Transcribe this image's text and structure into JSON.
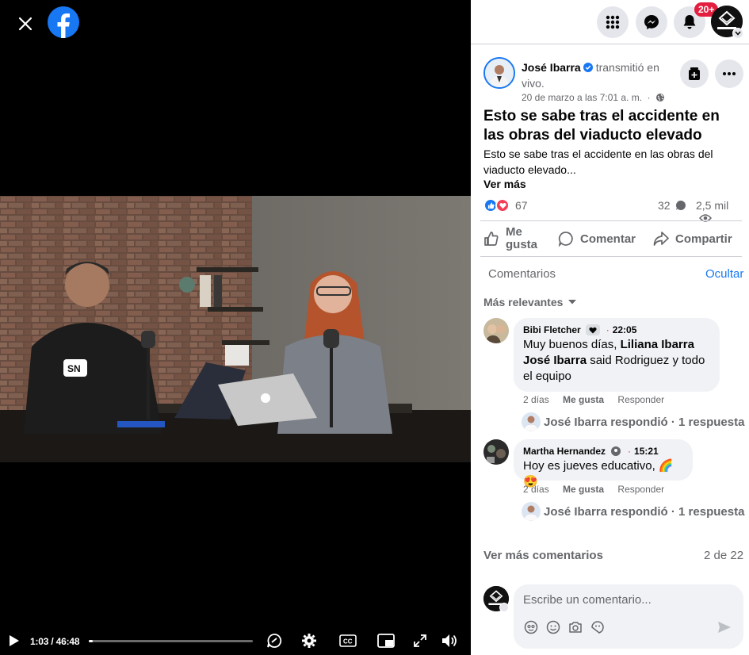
{
  "video": {
    "current_time": "1:03",
    "duration": "46:48",
    "time_display": "1:03 / 46:48",
    "progress_fraction": 0.022
  },
  "header": {
    "notifications_badge": "20+",
    "icons": [
      "menu-grid-icon",
      "messenger-icon",
      "bell-icon"
    ]
  },
  "post": {
    "author": "José Ibarra",
    "action": "transmitió en vivo.",
    "date": "20 de marzo a las 7:01 a. m.",
    "separator": "·",
    "title": "Esto se sabe tras el accidente en las obras del viaducto elevado",
    "text": "Esto se sabe tras el accidente en las obras del viaducto elevado...",
    "see_more": "Ver más",
    "reactions_count": "67",
    "comments_count": "32",
    "views_count": "2,5 mil"
  },
  "actions": {
    "like": "Me gusta",
    "comment": "Comentar",
    "share": "Compartir"
  },
  "comments": {
    "header": "Comentarios",
    "hide": "Ocultar",
    "sort": "Más relevantes",
    "items": [
      {
        "name": "Bibi Fletcher",
        "time": "22:05",
        "text_parts": [
          "Muy buenos días, ",
          "Liliana Ibarra José Ibarra",
          " said Rodriguez y todo el equipo"
        ],
        "age": "2 días",
        "like": "Me gusta",
        "reply": "Responder",
        "reply_summary": "José Ibarra respondió · 1 respuesta"
      },
      {
        "name": "Martha Hernandez",
        "time": "15:21",
        "text": "Hoy es jueves educativo, 🌈😍",
        "age": "2 días",
        "like": "Me gusta",
        "reply": "Responder",
        "reply_summary": "José Ibarra respondió · 1 respuesta"
      }
    ],
    "more": "Ver más comentarios",
    "range": "2 de 22",
    "composer_placeholder": "Escribe un comentario..."
  },
  "colors": {
    "accent": "#1877f2",
    "badge": "#e41e3f",
    "love": "#f33e58",
    "muted_text": "#65676b",
    "bubble": "#f0f2f5"
  }
}
